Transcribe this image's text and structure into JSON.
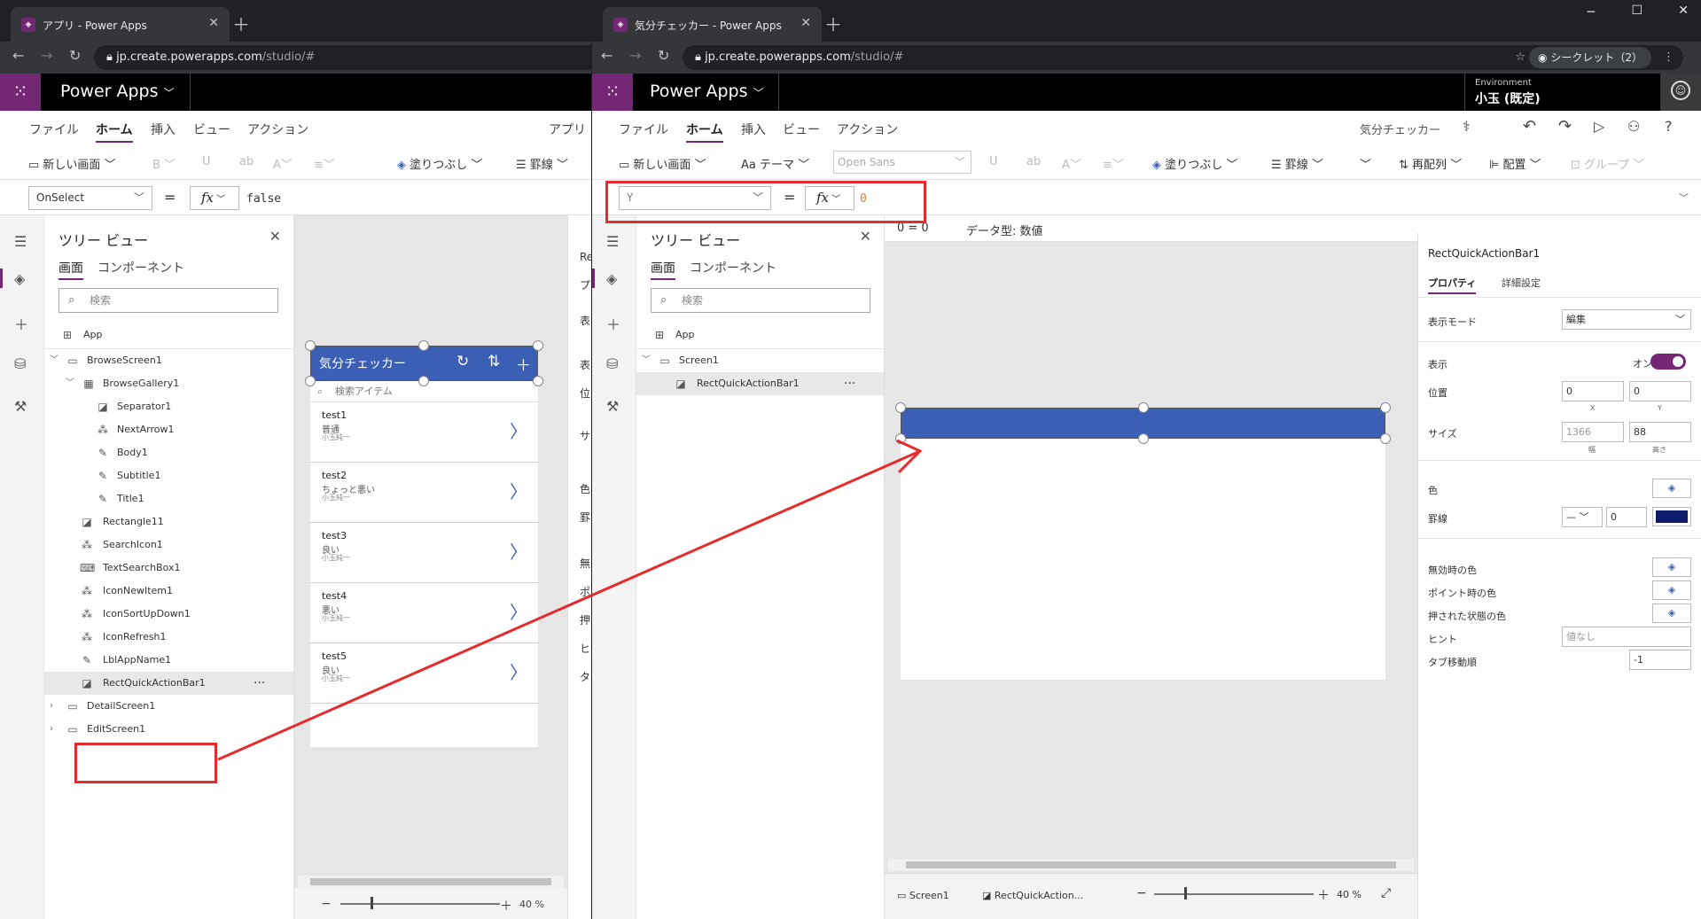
{
  "left_window": {
    "tab_title": "アプリ - Power Apps",
    "url_host": "jp.create.powerapps.com",
    "url_path": "/studio/#",
    "app_name": "Power Apps",
    "menu": [
      "ファイル",
      "ホーム",
      "挿入",
      "ビュー",
      "アクション",
      "アプリ"
    ],
    "ribbon": {
      "new_screen": "新しい画面",
      "bold": "B",
      "fill": "塗りつぶし",
      "border": "罫線"
    },
    "formula": {
      "property": "OnSelect",
      "fx": "fx",
      "value": "false"
    },
    "tree": {
      "title": "ツリー ビュー",
      "tab_screens": "画面",
      "tab_components": "コンポーネント",
      "search_placeholder": "検索",
      "items": [
        {
          "label": "App"
        },
        {
          "label": "BrowseScreen1"
        },
        {
          "label": "BrowseGallery1"
        },
        {
          "label": "Separator1"
        },
        {
          "label": "NextArrow1"
        },
        {
          "label": "Body1"
        },
        {
          "label": "Subtitle1"
        },
        {
          "label": "Title1"
        },
        {
          "label": "Rectangle11"
        },
        {
          "label": "SearchIcon1"
        },
        {
          "label": "TextSearchBox1"
        },
        {
          "label": "IconNewItem1"
        },
        {
          "label": "IconSortUpDown1"
        },
        {
          "label": "IconRefresh1"
        },
        {
          "label": "LblAppName1"
        },
        {
          "label": "RectQuickActionBar1"
        },
        {
          "label": "DetailScreen1"
        },
        {
          "label": "EditScreen1"
        }
      ],
      "more": "···"
    },
    "preview": {
      "app_title": "気分チェッカー",
      "search_placeholder": "検索アイテム",
      "gallery": [
        {
          "title": "test1",
          "subtitle": "普通",
          "body": "小玉純一"
        },
        {
          "title": "test2",
          "subtitle": "ちょっと悪い",
          "body": "小玉純一"
        },
        {
          "title": "test3",
          "subtitle": "良い",
          "body": "小玉純一"
        },
        {
          "title": "test4",
          "subtitle": "悪い",
          "body": "小玉純一"
        },
        {
          "title": "test5",
          "subtitle": "良い",
          "body": "小玉純一"
        }
      ]
    },
    "zoom": "40  %",
    "side_snips": [
      "Re",
      "プ",
      "表",
      "表",
      "位",
      "サ",
      "色",
      "罫",
      "無",
      "ポ",
      "押",
      "ヒ",
      "タ"
    ]
  },
  "right_window": {
    "tab_title": "気分チェッカー - Power Apps",
    "url_host": "jp.create.powerapps.com",
    "url_path": "/studio/#",
    "incognito": "シークレット（2）",
    "app_name": "Power Apps",
    "environment_label": "Environment",
    "environment_name": "小玉 (既定)",
    "menu": [
      "ファイル",
      "ホーム",
      "挿入",
      "ビュー",
      "アクション"
    ],
    "app_label": "気分チェッカー",
    "ribbon": {
      "new_screen": "新しい画面",
      "theme": "テーマ",
      "font": "Open Sans",
      "fill": "塗りつぶし",
      "border": "罫線",
      "reorder": "再配列",
      "align": "配置",
      "group": "グループ"
    },
    "formula": {
      "property": "Y",
      "fx": "fx",
      "value": "0",
      "eval": "0  =  0",
      "datatype": "データ型: 数値"
    },
    "tree": {
      "title": "ツリー ビュー",
      "tab_screens": "画面",
      "tab_components": "コンポーネント",
      "search_placeholder": "検索",
      "items": [
        {
          "label": "App"
        },
        {
          "label": "Screen1"
        },
        {
          "label": "RectQuickActionBar1"
        }
      ],
      "more": "···"
    },
    "bottom": {
      "screen": "Screen1",
      "control": "RectQuickAction...",
      "zoom": "40  %"
    },
    "props": {
      "control_name": "RectQuickActionBar1",
      "tab_props": "プロパティ",
      "tab_advanced": "詳細設定",
      "display_mode_label": "表示モード",
      "display_mode_value": "編集",
      "visible_label": "表示",
      "visible_value": "オン",
      "position_label": "位置",
      "x": "0",
      "y": "0",
      "x_sub": "X",
      "y_sub": "Y",
      "size_label": "サイズ",
      "width": "1366",
      "height": "88",
      "w_sub": "幅",
      "h_sub": "高さ",
      "color_label": "色",
      "border_label": "罫線",
      "border_width": "0",
      "disabled_color_label": "無効時の色",
      "hover_color_label": "ポイント時の色",
      "pressed_color_label": "押された状態の色",
      "tooltip_label": "ヒント",
      "tooltip_placeholder": "値なし",
      "tab_index_label": "タブ移動順",
      "tab_index_value": "-1"
    }
  },
  "colors": {
    "brand": "#742774",
    "bar": "#3a5fb5",
    "highlight": "#e52b2b",
    "border_swatch": "#0e1b6b"
  }
}
